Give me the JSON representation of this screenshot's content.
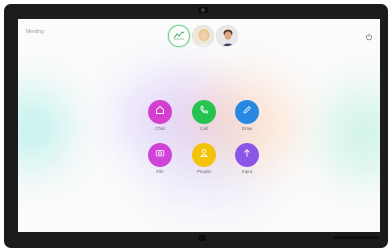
{
  "header": {
    "room_name": "Meeting",
    "icons": [
      "chart-icon",
      "power-icon"
    ]
  },
  "participants": [
    "woman-avatar",
    "man-avatar"
  ],
  "tiles": [
    {
      "label": "Chat",
      "color": "#d43fd0",
      "icon": "home-icon"
    },
    {
      "label": "Call",
      "color": "#27c351",
      "icon": "phone-icon"
    },
    {
      "label": "Draw",
      "color": "#2688e0",
      "icon": "pencil-icon"
    },
    {
      "label": "File",
      "color": "#d043d8",
      "icon": "camera-icon"
    },
    {
      "label": "People",
      "color": "#f5c20a",
      "icon": "person-icon"
    },
    {
      "label": "Input",
      "color": "#8b55e8",
      "icon": "upload-icon"
    }
  ]
}
